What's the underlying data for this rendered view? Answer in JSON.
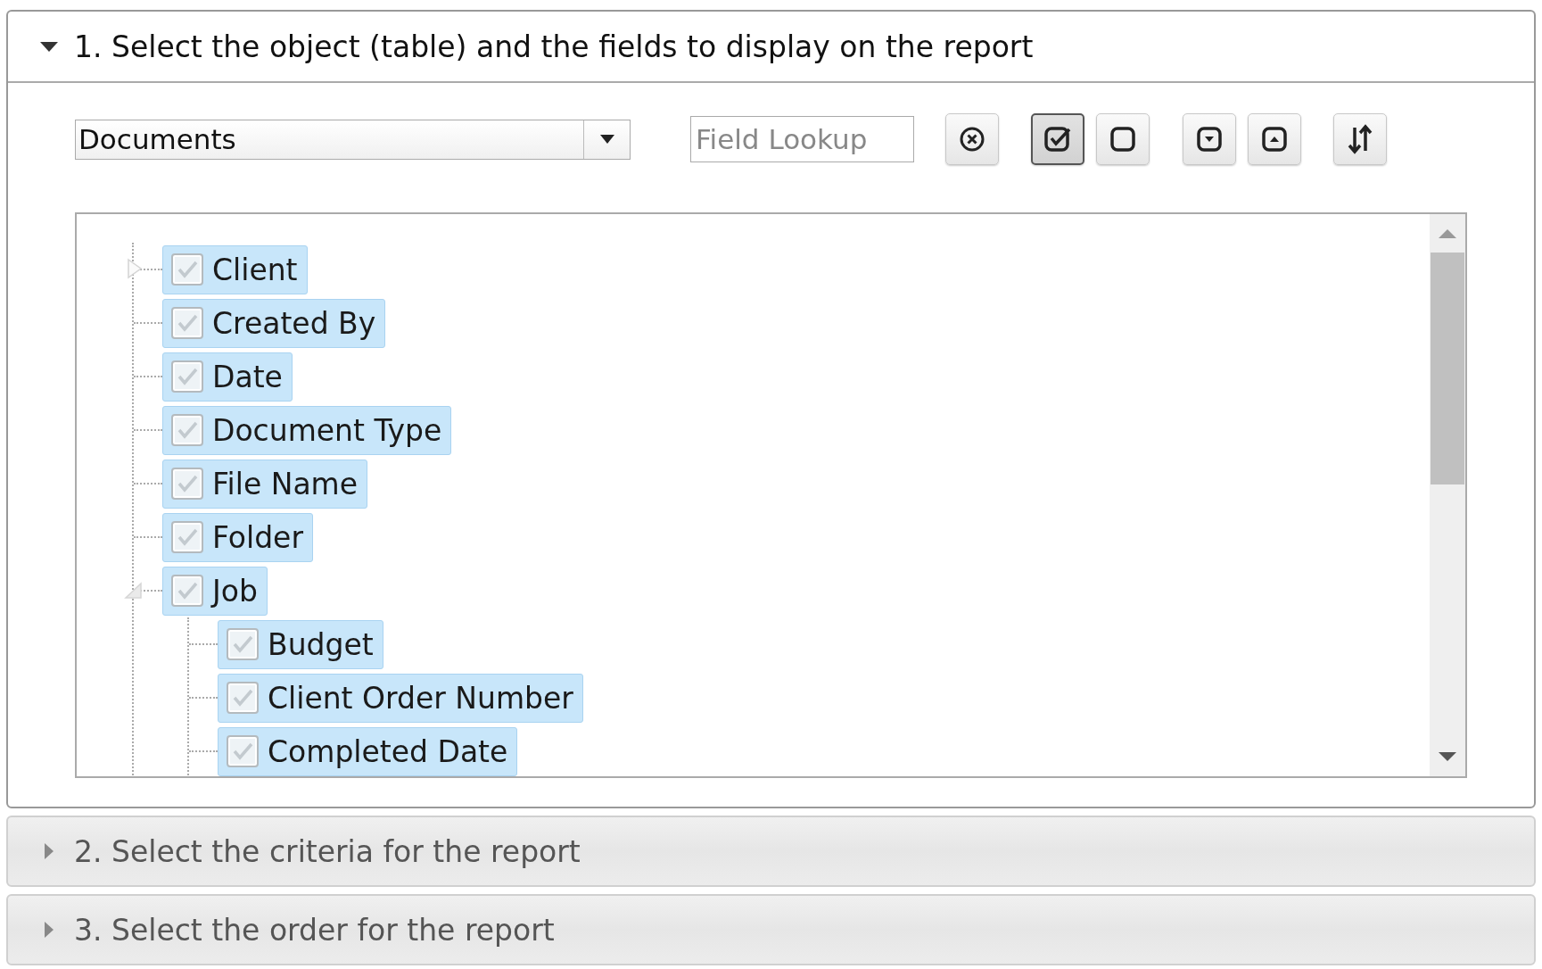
{
  "sections": [
    {
      "title": "1. Select the object (table) and the fields to display on the report",
      "expanded": true,
      "object_select": {
        "value": "Documents"
      },
      "field_lookup": {
        "placeholder": "Field Lookup"
      },
      "toolbar": [
        {
          "kind": "clear",
          "selected": false
        },
        {
          "kind": "check-all",
          "selected": true
        },
        {
          "kind": "uncheck-all",
          "selected": false
        },
        {
          "kind": "expand-all",
          "selected": false
        },
        {
          "kind": "collapse-all",
          "selected": false
        },
        {
          "kind": "sort",
          "selected": false
        }
      ],
      "tree": [
        {
          "label": "Client",
          "checked": true,
          "expanded": false
        },
        {
          "label": "Created By",
          "checked": true
        },
        {
          "label": "Date",
          "checked": true
        },
        {
          "label": "Document Type",
          "checked": true
        },
        {
          "label": "File Name",
          "checked": true
        },
        {
          "label": "Folder",
          "checked": true
        },
        {
          "label": "Job",
          "checked": true,
          "expanded": true,
          "children": [
            {
              "label": "Budget",
              "checked": true
            },
            {
              "label": "Client Order Number",
              "checked": true
            },
            {
              "label": "Completed Date",
              "checked": true
            }
          ]
        }
      ]
    },
    {
      "title": "2. Select the criteria for the report",
      "expanded": false
    },
    {
      "title": "3. Select the order for the report",
      "expanded": false
    }
  ]
}
